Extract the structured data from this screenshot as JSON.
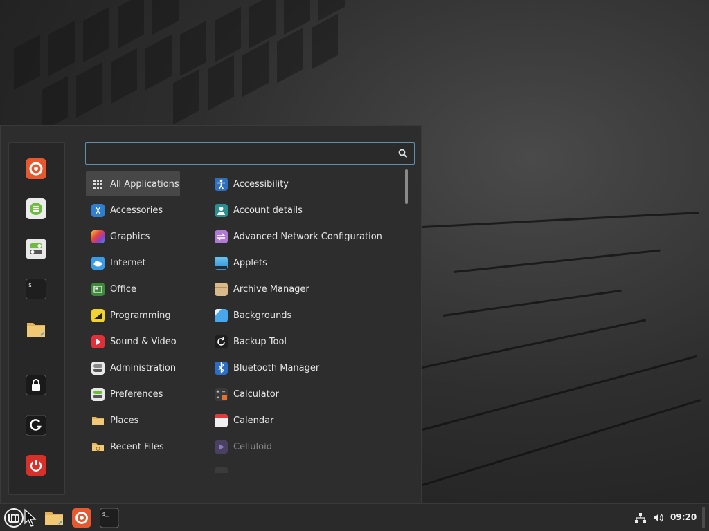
{
  "search": {
    "value": "",
    "placeholder": ""
  },
  "favorites": [
    {
      "name": "Firefox",
      "icon": "firefox-icon"
    },
    {
      "name": "Software Manager",
      "icon": "software-manager-icon"
    },
    {
      "name": "System Settings",
      "icon": "settings-toggle-icon"
    },
    {
      "name": "Terminal",
      "icon": "terminal-icon"
    },
    {
      "name": "Files",
      "icon": "folder-icon"
    },
    {
      "name": "Lock Screen",
      "icon": "lock-icon"
    },
    {
      "name": "Logout",
      "icon": "logout-icon"
    },
    {
      "name": "Quit",
      "icon": "power-icon"
    }
  ],
  "categories": [
    {
      "label": "All Applications",
      "icon": "grid-icon",
      "selected": true
    },
    {
      "label": "Accessories",
      "icon": "scissors-icon"
    },
    {
      "label": "Graphics",
      "icon": "graphics-icon"
    },
    {
      "label": "Internet",
      "icon": "cloud-icon"
    },
    {
      "label": "Office",
      "icon": "office-icon"
    },
    {
      "label": "Programming",
      "icon": "programming-icon"
    },
    {
      "label": "Sound & Video",
      "icon": "play-icon"
    },
    {
      "label": "Administration",
      "icon": "admin-toggle-icon"
    },
    {
      "label": "Preferences",
      "icon": "preferences-toggle-icon"
    },
    {
      "label": "Places",
      "icon": "folder-icon"
    },
    {
      "label": "Recent Files",
      "icon": "recent-folder-icon"
    }
  ],
  "apps": [
    {
      "label": "Accessibility",
      "icon": "accessibility-icon"
    },
    {
      "label": "Account details",
      "icon": "account-icon"
    },
    {
      "label": "Advanced Network Configuration",
      "icon": "network-config-icon"
    },
    {
      "label": "Applets",
      "icon": "applets-icon"
    },
    {
      "label": "Archive Manager",
      "icon": "archive-icon"
    },
    {
      "label": "Backgrounds",
      "icon": "backgrounds-icon"
    },
    {
      "label": "Backup Tool",
      "icon": "backup-icon"
    },
    {
      "label": "Bluetooth Manager",
      "icon": "bluetooth-icon"
    },
    {
      "label": "Calculator",
      "icon": "calculator-icon"
    },
    {
      "label": "Calendar",
      "icon": "calendar-icon"
    },
    {
      "label": "Celluloid",
      "icon": "celluloid-icon"
    }
  ],
  "taskbar": {
    "menu_button": "mint-menu-icon",
    "launchers": [
      "folder-icon",
      "firefox-icon",
      "terminal-icon"
    ]
  },
  "tray": {
    "clock": "09:20"
  }
}
